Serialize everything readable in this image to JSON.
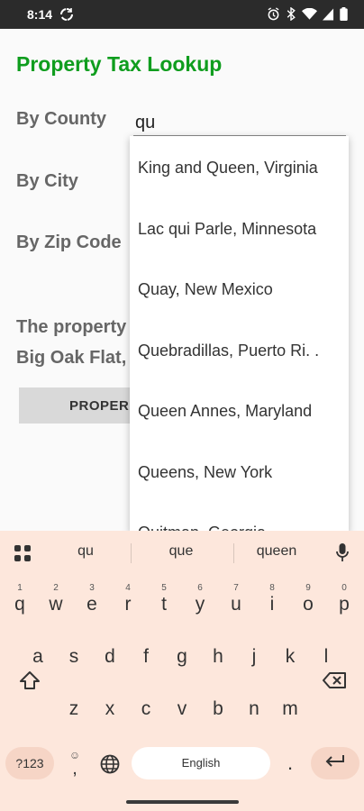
{
  "status_bar": {
    "time": "8:14"
  },
  "app": {
    "title": "Property Tax Lookup"
  },
  "form": {
    "county_label": "By County",
    "county_value": "qu",
    "city_label": "By City",
    "zip_label": "By Zip Code"
  },
  "result": {
    "line1": "The property",
    "line2": "Big Oak Flat,"
  },
  "button": {
    "label": "PROPER"
  },
  "dropdown": {
    "items": [
      "King and Queen, Virginia",
      "Lac qui Parle, Minnesota",
      "Quay, New Mexico",
      "Quebradillas, Puerto Ri. .",
      "Queen Annes, Maryland",
      "Queens, New York",
      "Quitman, Georgia"
    ]
  },
  "keyboard": {
    "suggestions": [
      "qu",
      "que",
      "queen"
    ],
    "row1": [
      {
        "k": "q",
        "h": "1"
      },
      {
        "k": "w",
        "h": "2"
      },
      {
        "k": "e",
        "h": "3"
      },
      {
        "k": "r",
        "h": "4"
      },
      {
        "k": "t",
        "h": "5"
      },
      {
        "k": "y",
        "h": "6"
      },
      {
        "k": "u",
        "h": "7"
      },
      {
        "k": "i",
        "h": "8"
      },
      {
        "k": "o",
        "h": "9"
      },
      {
        "k": "p",
        "h": "0"
      }
    ],
    "row2": [
      "a",
      "s",
      "d",
      "f",
      "g",
      "h",
      "j",
      "k",
      "l"
    ],
    "row3": [
      "z",
      "x",
      "c",
      "v",
      "b",
      "n",
      "m"
    ],
    "symbols_label": "?123",
    "comma_label": ",",
    "space_label": "English",
    "period_label": "."
  }
}
